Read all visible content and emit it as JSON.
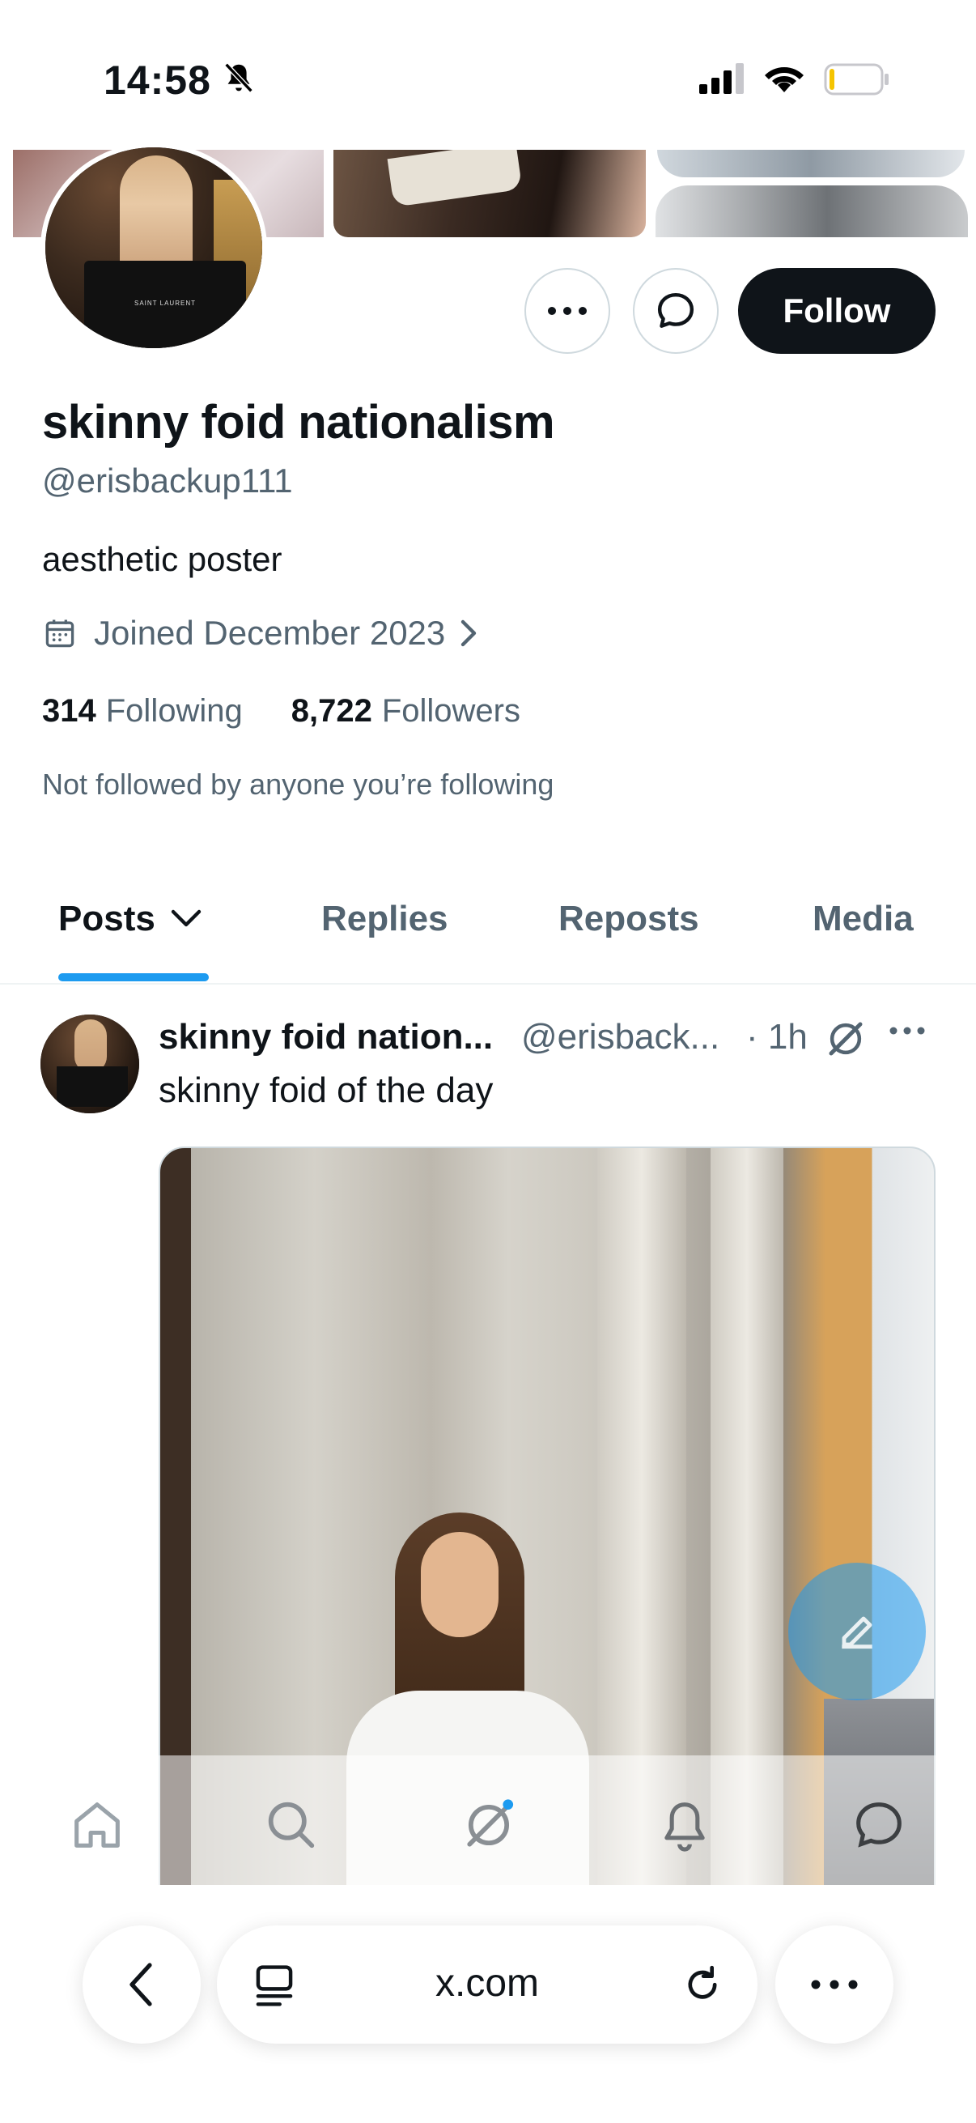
{
  "status_bar": {
    "time": "14:58",
    "icons": [
      "bell-slash-icon",
      "signal-icon",
      "wifi-icon",
      "battery-icon"
    ]
  },
  "profile": {
    "display_name": "skinny foid nationalism",
    "handle": "@erisbackup111",
    "bio": "aesthetic poster",
    "joined": "Joined December 2023",
    "following_count": "314",
    "following_label": "Following",
    "followers_count": "8,722",
    "followers_label": "Followers",
    "not_followed_text": "Not followed by anyone you’re following",
    "avatar_bag_text": "SAINT LAURENT",
    "follow_button": "Follow"
  },
  "tabs": [
    {
      "label": "Posts",
      "active": true
    },
    {
      "label": "Replies",
      "active": false
    },
    {
      "label": "Reposts",
      "active": false
    },
    {
      "label": "Media",
      "active": false
    }
  ],
  "post": {
    "author_name": "skinny foid nation...",
    "author_handle": "@erisback...",
    "time": "· 1h",
    "text": "skinny foid of the day"
  },
  "browser": {
    "url": "x.com"
  },
  "colors": {
    "accent": "#1d9bf0",
    "text_primary": "#0f1419",
    "text_secondary": "#536471",
    "follow_bg": "#0f1419"
  }
}
